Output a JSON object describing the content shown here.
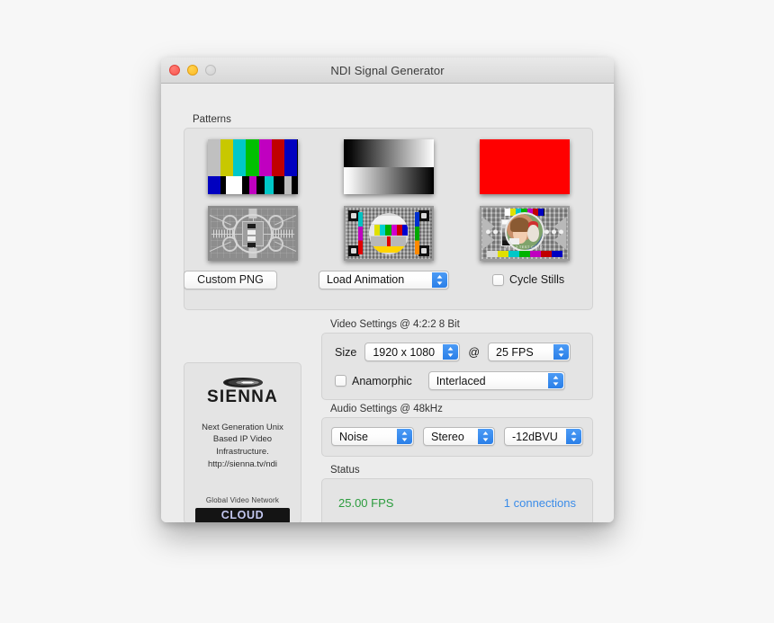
{
  "window": {
    "title": "NDI Signal Generator",
    "traffic_lights": [
      "close",
      "minimize",
      "zoom"
    ]
  },
  "patterns": {
    "group_label": "Patterns",
    "thumbnails": [
      {
        "name": "color-bars",
        "type": "smpte-bars"
      },
      {
        "name": "gray-ramp",
        "type": "gradient-ramp"
      },
      {
        "name": "flat-red",
        "type": "flat-color",
        "color": "#FF0000"
      },
      {
        "name": "monoscope",
        "type": "grayscale-test-card"
      },
      {
        "name": "pm5544",
        "type": "color-test-card"
      },
      {
        "name": "test-card-f",
        "type": "photo-test-card"
      }
    ],
    "bar_colors": [
      "#c0c0c0",
      "#c8c800",
      "#00c8c8",
      "#00c000",
      "#c000c0",
      "#c00000",
      "#0000c0"
    ],
    "bottom_bar_colors": [
      "#0000c0",
      "#000000",
      "#ffffff",
      "#000000",
      "#c000c0",
      "#000000",
      "#00c8c8",
      "#000000",
      "#bdbdbd",
      "#000000"
    ],
    "custom_png_button": "Custom PNG",
    "load_animation_popup": "Load Animation",
    "cycle_stills_checkbox": "Cycle Stills",
    "cycle_stills_checked": false,
    "testcard_label": "BBC 2 TEST CARD"
  },
  "branding": {
    "logo_word": "SIENNA",
    "tagline_lines": [
      "Next Generation Unix",
      "Based IP Video",
      "Infrastructure.",
      "http://sienna.tv/ndi"
    ],
    "network_label": "Global Video Network",
    "cloud_badge": "CLOUD"
  },
  "video_settings": {
    "group_label": "Video Settings @ 4:2:2 8 Bit",
    "size_label": "Size",
    "size_value": "1920 x 1080",
    "at_symbol": "@",
    "fps_value": "25 FPS",
    "anamorphic_label": "Anamorphic",
    "anamorphic_checked": false,
    "scan_value": "Interlaced"
  },
  "audio_settings": {
    "group_label": "Audio Settings @ 48kHz",
    "source_value": "Noise",
    "channels_value": "Stereo",
    "level_value": "-12dBVU"
  },
  "status": {
    "group_label": "Status",
    "fps": "25.00 FPS",
    "connections": "1 connections",
    "fps_color": "#2c9c3e",
    "connections_color": "#3b8ce8"
  }
}
